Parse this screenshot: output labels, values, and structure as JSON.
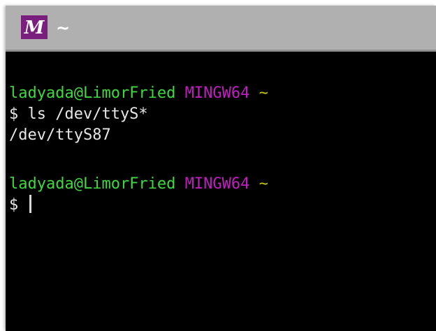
{
  "window": {
    "title": "~",
    "icon": "mingw-m-icon",
    "icon_letter": "M"
  },
  "terminal": {
    "prompt1": {
      "user_host": "ladyada@LimorFried",
      "shell": "MINGW64",
      "path": "~"
    },
    "command1": "$ ls /dev/ttyS*",
    "output1": "/dev/ttyS87",
    "prompt2": {
      "user_host": "ladyada@LimorFried",
      "shell": "MINGW64",
      "path": "~"
    },
    "input_prompt": "$ "
  },
  "colors": {
    "user_host": "#3fd83f",
    "shell": "#c01ec0",
    "path": "#c8c800",
    "text": "#e6e6e6",
    "background": "#000000",
    "titlebar": "#b0b0b0",
    "icon_bg": "#7a1f7d"
  }
}
